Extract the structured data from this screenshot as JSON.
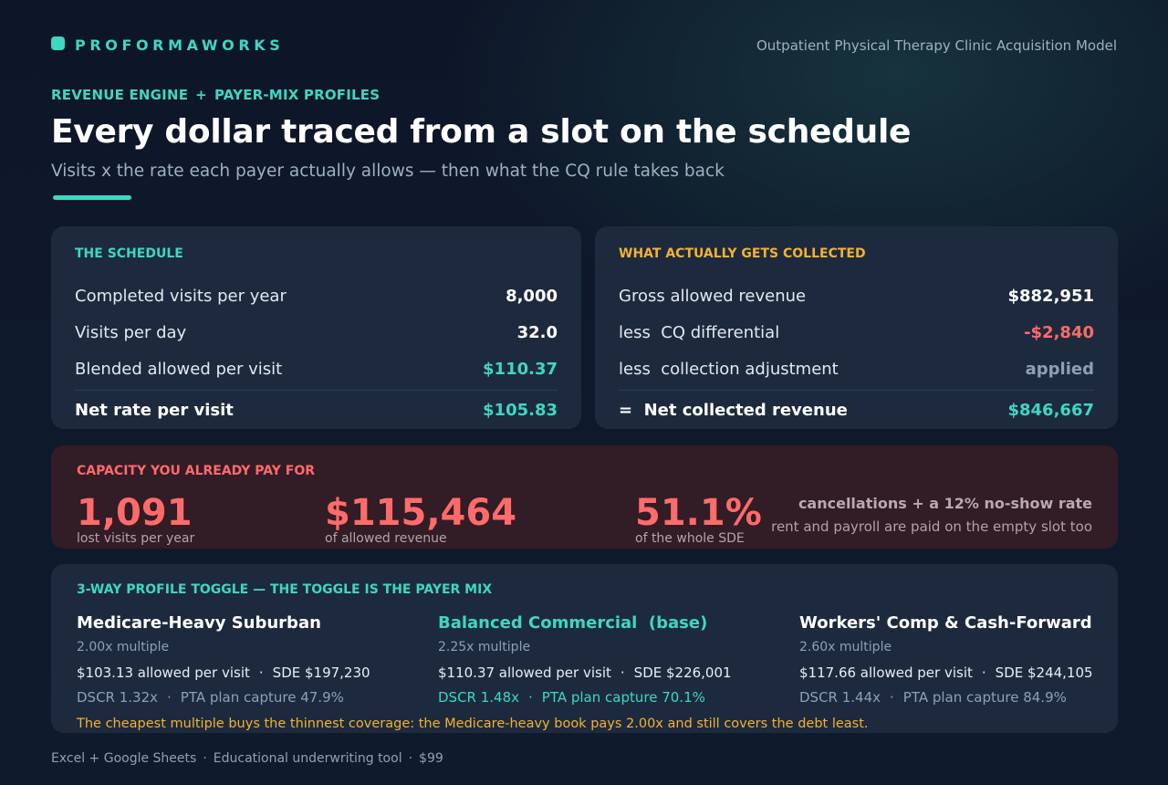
{
  "brand": {
    "name": "PROFORMAWORKS",
    "doc_title": "Outpatient Physical Therapy Clinic Acquisition Model"
  },
  "hero": {
    "kicker_left": "REVENUE ENGINE",
    "kicker_plus": "+",
    "kicker_right": "PAYER-MIX PROFILES",
    "title": "Every dollar traced from a slot on the schedule",
    "subtitle": "Visits x the rate each payer actually allows — then what the CQ rule takes back"
  },
  "schedule": {
    "label": "THE SCHEDULE",
    "rows": [
      {
        "key": "Completed visits per year",
        "value": "8,000"
      },
      {
        "key": "Visits per day",
        "value": "32.0"
      },
      {
        "key": "Blended allowed per visit",
        "value": "$110.37"
      }
    ],
    "total": {
      "key": "Net rate per visit",
      "value": "$105.83"
    }
  },
  "collected": {
    "label": "WHAT ACTUALLY GETS COLLECTED",
    "rows": [
      {
        "key": "Gross allowed revenue",
        "value": "$882,951"
      },
      {
        "key": "less  CQ differential",
        "value": "-$2,840"
      },
      {
        "key": "less  collection adjustment",
        "value": "applied"
      }
    ],
    "total": {
      "key": "=  Net collected revenue",
      "value": "$846,667"
    }
  },
  "capacity": {
    "label": "CAPACITY YOU ALREADY PAY FOR",
    "stats": [
      {
        "value": "1,091",
        "caption": "lost visits per year"
      },
      {
        "value": "$115,464",
        "caption": "of allowed revenue"
      },
      {
        "value": "51.1%",
        "caption": "of the whole SDE"
      }
    ],
    "note_line1": "cancellations + a 12% no-show rate",
    "note_line2": "rent and payroll are paid on the empty slot too"
  },
  "toggle": {
    "label": "3-WAY PROFILE TOGGLE — THE TOGGLE IS THE PAYER MIX",
    "separator": "·",
    "profiles": [
      {
        "name": "Medicare-Heavy Suburban",
        "multiple": "2.00x multiple",
        "allowed": "$103.13 allowed per visit",
        "sde": "SDE $197,230",
        "dscr": "DSCR 1.32x",
        "pta": "PTA plan capture 47.9%"
      },
      {
        "name": "Balanced Commercial  (base)",
        "multiple": "2.25x multiple",
        "allowed": "$110.37 allowed per visit",
        "sde": "SDE $226,001",
        "dscr": "DSCR 1.48x",
        "pta": "PTA plan capture 70.1%"
      },
      {
        "name": "Workers' Comp & Cash-Forward",
        "multiple": "2.60x multiple",
        "allowed": "$117.66 allowed per visit",
        "sde": "SDE $244,105",
        "dscr": "DSCR 1.44x",
        "pta": "PTA plan capture 84.9%"
      }
    ],
    "footnote": "The cheapest multiple buys the thinnest coverage: the Medicare-heavy book pays 2.00x and still covers the debt least."
  },
  "footer": {
    "item1": "Excel + Google Sheets",
    "item2": "Educational underwriting tool",
    "item3": "$99",
    "separator": "·"
  },
  "colors": {
    "accent": "#3fd6c2",
    "negative": "#ff6b6b",
    "warning": "#f2b233",
    "card": "#1d2a3d",
    "alert_card": "#321c25"
  }
}
